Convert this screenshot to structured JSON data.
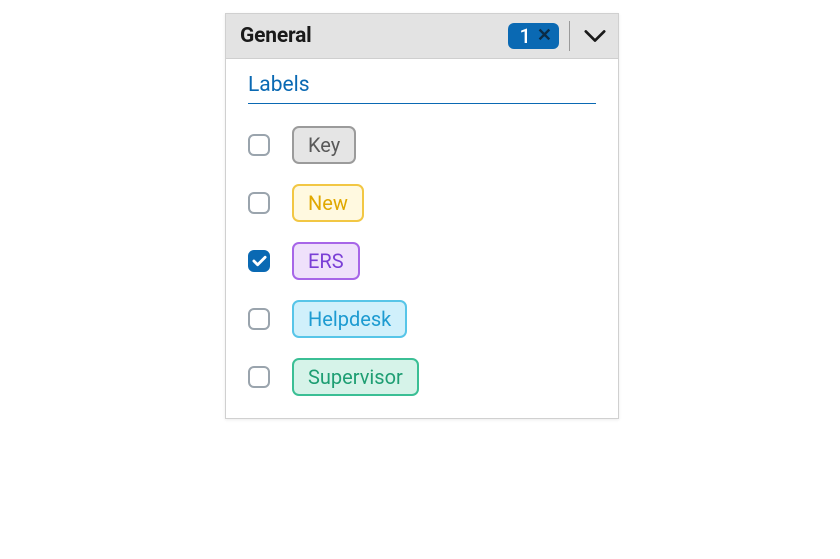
{
  "header": {
    "title": "General",
    "badge_count": "1"
  },
  "section": {
    "title": "Labels"
  },
  "labels": [
    {
      "text": "Key",
      "checked": false,
      "color": "#595959",
      "bg": "#e5e5e5",
      "border": "#9b9b9b"
    },
    {
      "text": "New",
      "checked": false,
      "color": "#e0a800",
      "bg": "#fff9e0",
      "border": "#f2c744"
    },
    {
      "text": "ERS",
      "checked": true,
      "color": "#7a3fd6",
      "bg": "#efe1fb",
      "border": "#a766e8"
    },
    {
      "text": "Helpdesk",
      "checked": false,
      "color": "#1d9bd1",
      "bg": "#d0f0fb",
      "border": "#57c5e8"
    },
    {
      "text": "Supervisor",
      "checked": false,
      "color": "#1e9e73",
      "bg": "#d6f3e9",
      "border": "#3bbf95"
    }
  ]
}
